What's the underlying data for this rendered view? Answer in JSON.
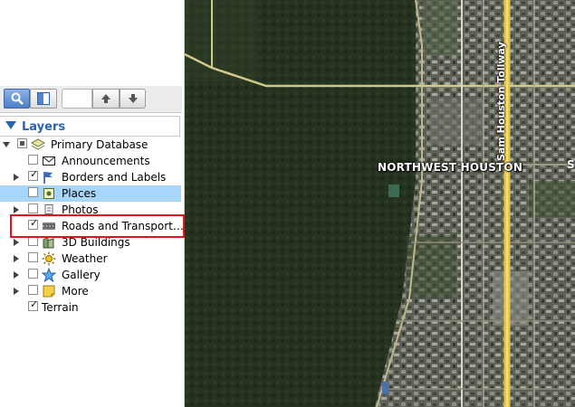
{
  "sidebar": {
    "toolbar": {
      "search_icon": "search-icon",
      "panel_icon": "panel-icon",
      "zoom_value": "",
      "up_icon": "arrow-up-icon",
      "down_icon": "arrow-down-icon"
    },
    "layers_title": "Layers",
    "items": [
      {
        "label": "Primary Database",
        "icon": "layers-stack-icon",
        "checkbox": "partial",
        "expander": "open"
      },
      {
        "label": "Announcements",
        "icon": "envelope-icon",
        "checkbox": "unchecked",
        "expander": "none"
      },
      {
        "label": "Borders and Labels",
        "icon": "flags-icon",
        "checkbox": "checked",
        "expander": "closed"
      },
      {
        "label": "Places",
        "icon": "places-icon",
        "checkbox": "unchecked",
        "expander": "none",
        "selected": true
      },
      {
        "label": "Photos",
        "icon": "photos-icon",
        "checkbox": "unchecked",
        "expander": "closed"
      },
      {
        "label": "Roads and Transport…",
        "icon": "road-icon",
        "checkbox": "checked",
        "expander": "none"
      },
      {
        "label": "3D Buildings",
        "icon": "buildings-icon",
        "checkbox": "unchecked",
        "expander": "closed"
      },
      {
        "label": "Weather",
        "icon": "sun-icon",
        "checkbox": "unchecked",
        "expander": "closed"
      },
      {
        "label": "Gallery",
        "icon": "star-icon",
        "checkbox": "unchecked",
        "expander": "closed"
      },
      {
        "label": "More",
        "icon": "note-icon",
        "checkbox": "unchecked",
        "expander": "closed"
      },
      {
        "label": "Terrain",
        "icon": "",
        "checkbox": "checked",
        "expander": "none"
      }
    ]
  },
  "map": {
    "area_label": "NORTHWEST HOUSTON",
    "edge_label": "S",
    "road_label": "Sam Houston Tollway",
    "colors": {
      "forest": "#23311f",
      "urban": "#6b6b62",
      "highway": "#e7c645",
      "road": "#cfc98a",
      "highlight": "#e6131b"
    }
  }
}
